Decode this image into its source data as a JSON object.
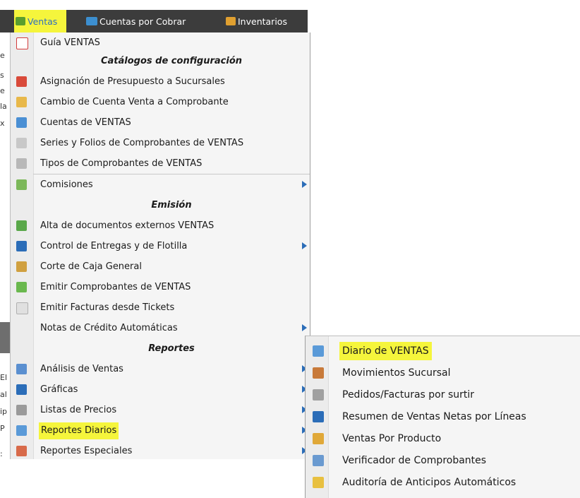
{
  "menubar": {
    "items": [
      {
        "label": "Ventas",
        "icon": "ventas-icon",
        "active": true
      },
      {
        "label": "Cuentas por Cobrar",
        "icon": "cuentas-por-cobrar-icon"
      },
      {
        "label": "Inventarios",
        "icon": "inventarios-icon"
      }
    ]
  },
  "menu": {
    "guia": "Guía VENTAS",
    "section_catalogos": "Catálogos de configuración",
    "catalogos": [
      "Asignación de Presupuesto a Sucursales",
      "Cambio de Cuenta Venta a Comprobante",
      "Cuentas de VENTAS",
      "Series y Folios de Comprobantes de VENTAS",
      "Tipos de Comprobantes de VENTAS"
    ],
    "comisiones": "Comisiones",
    "section_emision": "Emisión",
    "emision": [
      "Alta de documentos externos VENTAS",
      "Control de Entregas y de Flotilla",
      "Corte de Caja General",
      "Emitir Comprobantes de VENTAS",
      "Emitir Facturas desde Tickets",
      "Notas de Crédito Automáticas"
    ],
    "section_reportes": "Reportes",
    "reportes": [
      "Análisis de Ventas",
      "Gráficas",
      "Listas de Precios",
      "Reportes Diarios",
      "Reportes Especiales"
    ]
  },
  "submenu": {
    "items": [
      "Diario de VENTAS",
      "Movimientos Sucursal",
      "Pedidos/Facturas por surtir",
      "Resumen de Ventas Netas por Líneas",
      "Ventas Por Producto",
      "Verificador de Comprobantes",
      "Auditoría de Anticipos Automáticos"
    ]
  },
  "colors": {
    "highlight": "#f5f53c",
    "menubar_bg": "#3c3c3c",
    "arrow": "#2b6db8"
  }
}
